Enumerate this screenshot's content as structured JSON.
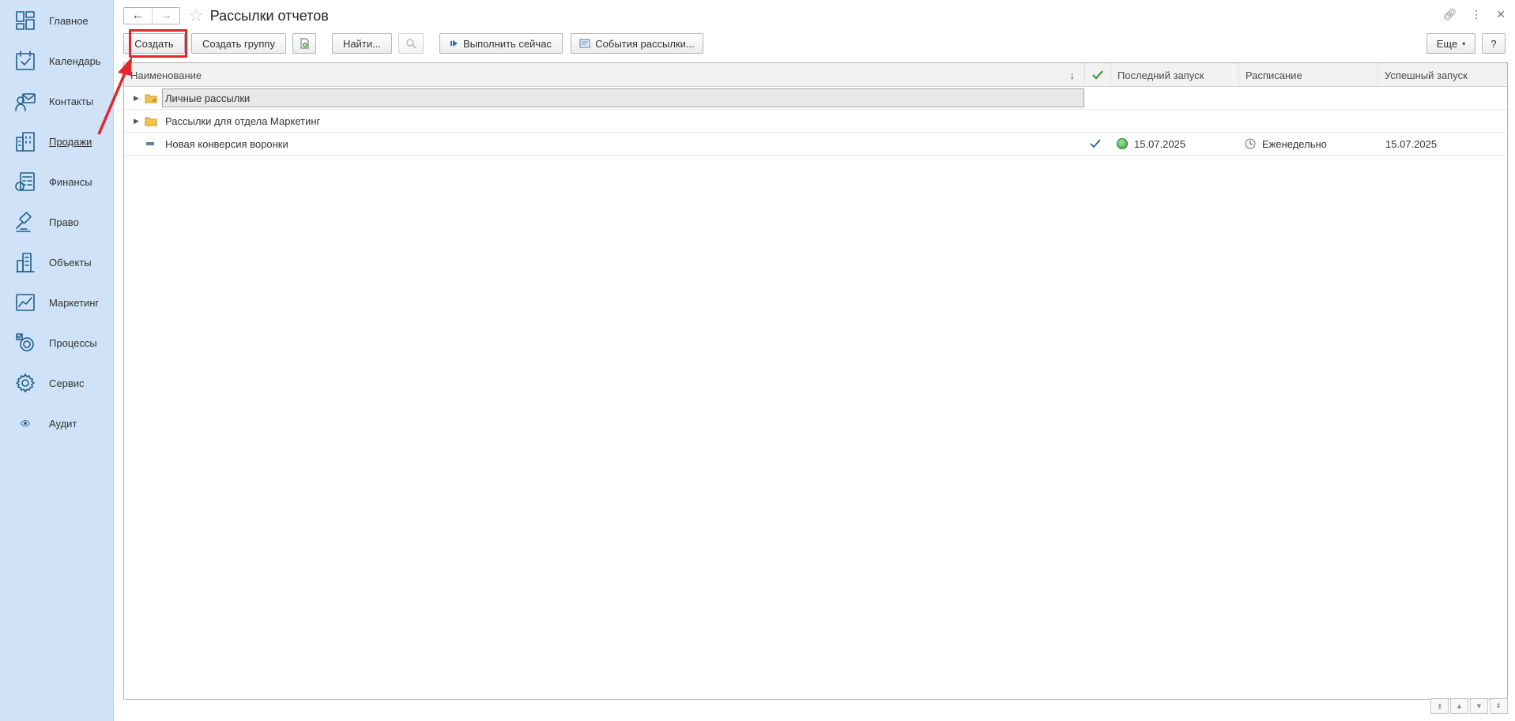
{
  "sidebar": {
    "items": [
      {
        "label": "Главное",
        "icon": "dashboard-icon"
      },
      {
        "label": "Календарь",
        "icon": "calendar-icon"
      },
      {
        "label": "Контакты",
        "icon": "contacts-icon"
      },
      {
        "label": "Продажи",
        "icon": "sales-icon"
      },
      {
        "label": "Финансы",
        "icon": "finance-icon"
      },
      {
        "label": "Право",
        "icon": "law-icon"
      },
      {
        "label": "Объекты",
        "icon": "buildings-icon"
      },
      {
        "label": "Маркетинг",
        "icon": "chart-icon"
      },
      {
        "label": "Процессы",
        "icon": "processes-icon"
      },
      {
        "label": "Сервис",
        "icon": "gear-icon"
      },
      {
        "label": "Аудит",
        "icon": "eye-icon"
      }
    ]
  },
  "header": {
    "title": "Рассылки отчетов"
  },
  "toolbar": {
    "create_label": "Создать",
    "create_group_label": "Создать группу",
    "find_label": "Найти...",
    "run_now_label": "Выполнить сейчас",
    "events_label": "События рассылки...",
    "more_label": "Еще",
    "help_label": "?"
  },
  "table": {
    "columns": {
      "name": "Наименование",
      "sort_indicator": "↓",
      "last_run": "Последний запуск",
      "schedule": "Расписание",
      "success_run": "Успешный запуск"
    },
    "rows": [
      {
        "name": "Личные рассылки"
      },
      {
        "name": "Рассылки для отдела Маркетинг"
      },
      {
        "name": "Новая конверсия воронки",
        "last_run": "15.07.2025",
        "schedule": "Еженедельно",
        "success_run": "15.07.2025"
      }
    ]
  },
  "colors": {
    "sidebar_bg": "#cfe2f7",
    "accent": "#1f5d8c",
    "highlight": "#e1262d",
    "status_ok": "#5cb85c"
  }
}
